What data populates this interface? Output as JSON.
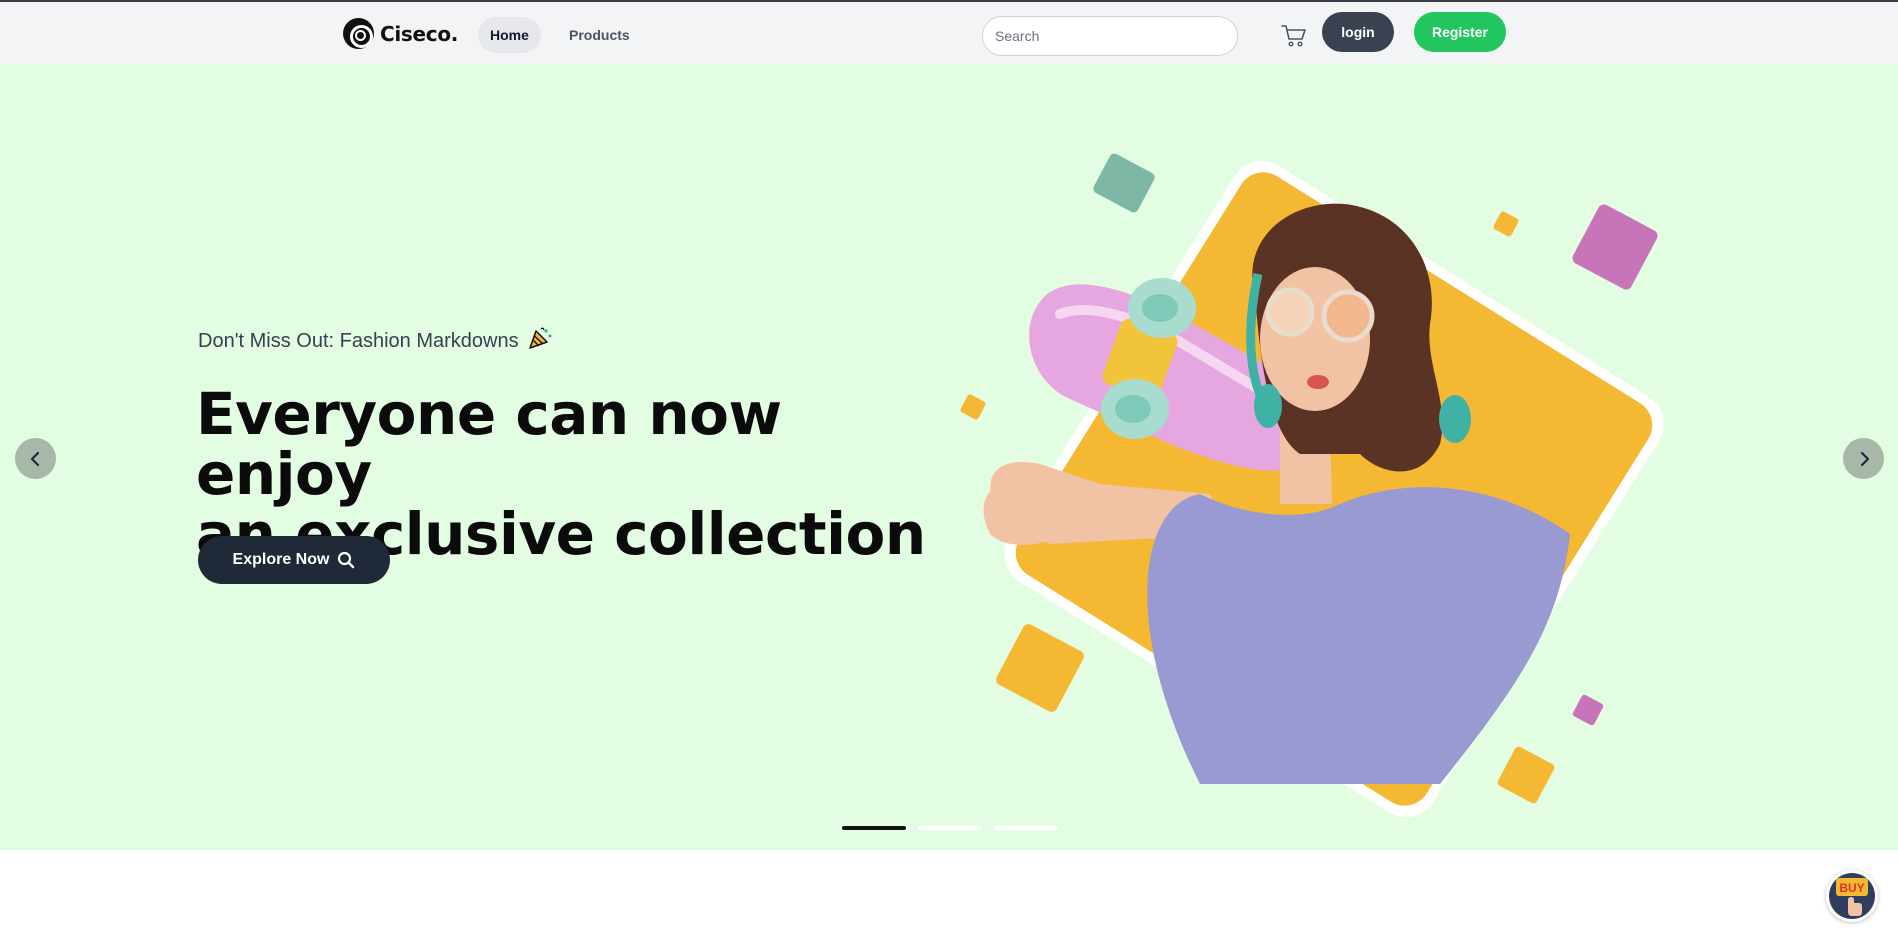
{
  "nav": {
    "logo_text": "Ciseco.",
    "links": [
      {
        "label": "Home",
        "active": true
      },
      {
        "label": "Products",
        "active": false
      }
    ],
    "search_placeholder": "Search",
    "login_label": "login",
    "register_label": "Register"
  },
  "hero": {
    "subtitle": "Don't Miss Out: Fashion Markdowns",
    "title_line1": "Everyone can now enjoy",
    "title_line2": "an exclusive collection",
    "cta_label": "Explore Now",
    "active_slide": 1,
    "slide_count": 3
  },
  "icons": {
    "cart": "cart-icon",
    "search": "search-icon",
    "prev": "chevron-left-icon",
    "next": "chevron-right-icon",
    "party": "party-popper-icon"
  },
  "colors": {
    "hero_bg": "#e3fde3",
    "brand_dark": "#1f2937",
    "register_green": "#22c55e",
    "login_dark": "#3a4150",
    "accent_yellow": "#f4b833",
    "accent_pink": "#c874b8",
    "accent_teal": "#7fb7a7",
    "shirt_lavender": "#9a9ad2"
  },
  "buy_widget_label": "BUY"
}
